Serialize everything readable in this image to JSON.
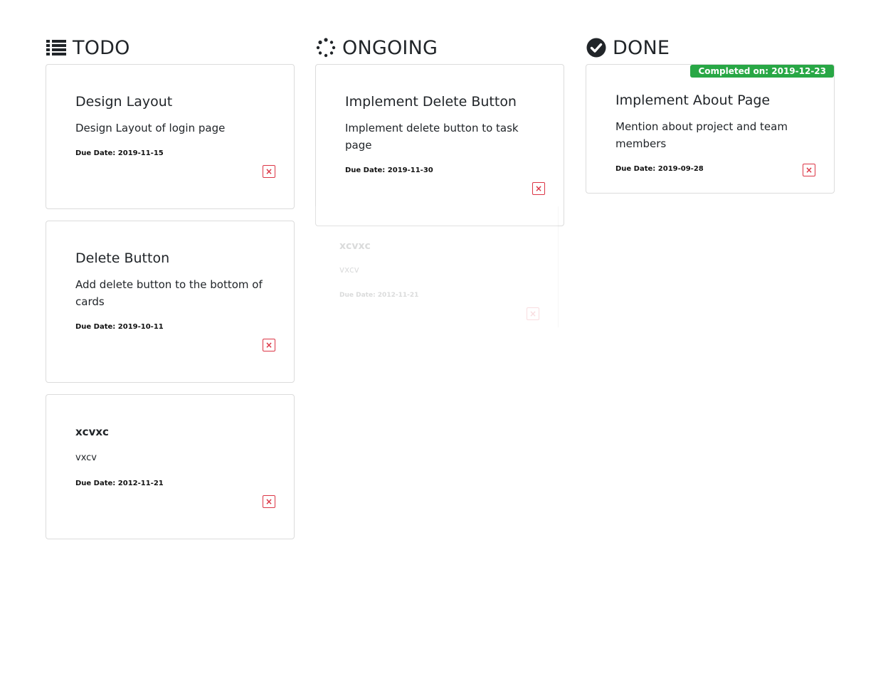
{
  "columns": {
    "todo": {
      "title": "TODO",
      "icon": "list-icon",
      "cards": [
        {
          "title": "Design Layout",
          "description": "Design Layout of login page",
          "due": "Due Date: 2019-11-15"
        },
        {
          "title": "Delete Button",
          "description": "Add delete button to the bottom of cards",
          "due": "Due Date: 2019-10-11"
        },
        {
          "title": "xcvxc",
          "description": "vxcv",
          "due": "Due Date: 2012-11-21"
        }
      ]
    },
    "ongoing": {
      "title": "ONGOING",
      "icon": "spinner-icon",
      "cards": [
        {
          "title": "Implement Delete Button",
          "description": "Implement delete button to task page",
          "due": "Due Date: 2019-11-30"
        }
      ],
      "dragging_card": {
        "title": "xcvxc",
        "description": "vxcv",
        "due": "Due Date: 2012-11-21"
      }
    },
    "done": {
      "title": "DONE",
      "icon": "check-circle-icon",
      "cards": [
        {
          "badge": "Completed on: 2019-12-23",
          "title": "Implement About Page",
          "description": "Mention about project and team members",
          "due": "Due Date: 2019-09-28"
        }
      ]
    }
  },
  "delete_symbol": "×",
  "colors": {
    "delete": "#dc3545",
    "badge": "#28a745",
    "text": "#212529"
  }
}
